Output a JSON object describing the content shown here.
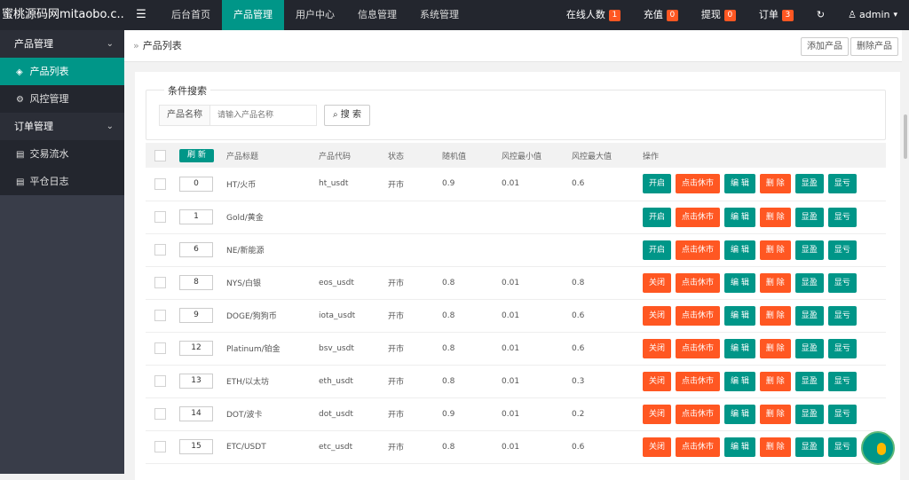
{
  "app": {
    "title": "蜜桃源码网mitaobo.c..."
  },
  "top_nav": {
    "menu_icon": "menu-icon",
    "items": [
      {
        "label": "后台首页",
        "active": false
      },
      {
        "label": "产品管理",
        "active": true
      },
      {
        "label": "用户中心",
        "active": false
      },
      {
        "label": "信息管理",
        "active": false
      },
      {
        "label": "系统管理",
        "active": false
      }
    ]
  },
  "top_right": {
    "online": {
      "label": "在线人数",
      "count": "1"
    },
    "recharge": {
      "label": "充值",
      "count": "0"
    },
    "withdraw": {
      "label": "提现",
      "count": "0"
    },
    "orders": {
      "label": "订单",
      "count": "3"
    },
    "refresh_icon": "refresh-icon",
    "user": {
      "label": "admin",
      "icon": "user-icon"
    }
  },
  "sidebar": {
    "groups": [
      {
        "label": "产品管理",
        "items": [
          {
            "label": "产品列表",
            "active": true,
            "icon": "layers-icon"
          },
          {
            "label": "风控管理",
            "active": false,
            "icon": "gear-icon"
          }
        ]
      },
      {
        "label": "订单管理",
        "items": [
          {
            "label": "交易流水",
            "active": false,
            "icon": "doc-icon"
          },
          {
            "label": "平仓日志",
            "active": false,
            "icon": "doc-icon"
          }
        ]
      }
    ]
  },
  "breadcrumb": {
    "separator": "»",
    "label": "产品列表"
  },
  "actions": {
    "add": "添加产品",
    "delete": "删除产品"
  },
  "search": {
    "legend": "条件搜索",
    "field_label": "产品名称",
    "placeholder": "请输入产品名称",
    "button": "搜 索"
  },
  "table": {
    "refresh_label": "刷 新",
    "headers": [
      "产品标题",
      "产品代码",
      "状态",
      "随机值",
      "风控最小值",
      "风控最大值",
      "操作"
    ],
    "rows": [
      {
        "sort": "0",
        "title": "HT/火币",
        "code": "ht_usdt",
        "status": "开市",
        "random": "0.9",
        "min": "0.01",
        "max": "0.6",
        "toggle": "开启",
        "toggle_color": "teal"
      },
      {
        "sort": "1",
        "title": "Gold/黄金",
        "code": "",
        "status": "",
        "random": "",
        "min": "",
        "max": "",
        "toggle": "开启",
        "toggle_color": "teal"
      },
      {
        "sort": "6",
        "title": "NE/新能源",
        "code": "",
        "status": "",
        "random": "",
        "min": "",
        "max": "",
        "toggle": "开启",
        "toggle_color": "teal"
      },
      {
        "sort": "8",
        "title": "NYS/白银",
        "code": "eos_usdt",
        "status": "开市",
        "random": "0.8",
        "min": "0.01",
        "max": "0.8",
        "toggle": "关闭",
        "toggle_color": "orange"
      },
      {
        "sort": "9",
        "title": "DOGE/狗狗币",
        "code": "iota_usdt",
        "status": "开市",
        "random": "0.8",
        "min": "0.01",
        "max": "0.6",
        "toggle": "关闭",
        "toggle_color": "orange"
      },
      {
        "sort": "12",
        "title": "Platinum/铂金",
        "code": "bsv_usdt",
        "status": "开市",
        "random": "0.8",
        "min": "0.01",
        "max": "0.6",
        "toggle": "关闭",
        "toggle_color": "orange"
      },
      {
        "sort": "13",
        "title": "ETH/以太坊",
        "code": "eth_usdt",
        "status": "开市",
        "random": "0.8",
        "min": "0.01",
        "max": "0.3",
        "toggle": "关闭",
        "toggle_color": "orange"
      },
      {
        "sort": "14",
        "title": "DOT/波卡",
        "code": "dot_usdt",
        "status": "开市",
        "random": "0.9",
        "min": "0.01",
        "max": "0.2",
        "toggle": "关闭",
        "toggle_color": "orange"
      },
      {
        "sort": "15",
        "title": "ETC/USDT",
        "code": "etc_usdt",
        "status": "开市",
        "random": "0.8",
        "min": "0.01",
        "max": "0.6",
        "toggle": "关闭",
        "toggle_color": "orange"
      }
    ],
    "row_buttons": {
      "holiday": "点击休市",
      "edit": "编 辑",
      "delete": "删 除",
      "profit": "显盈",
      "loss": "显亏"
    }
  },
  "colors": {
    "accent": "#009688",
    "danger": "#ff5722",
    "topbar": "#23262e",
    "sidebar": "#393d49"
  }
}
